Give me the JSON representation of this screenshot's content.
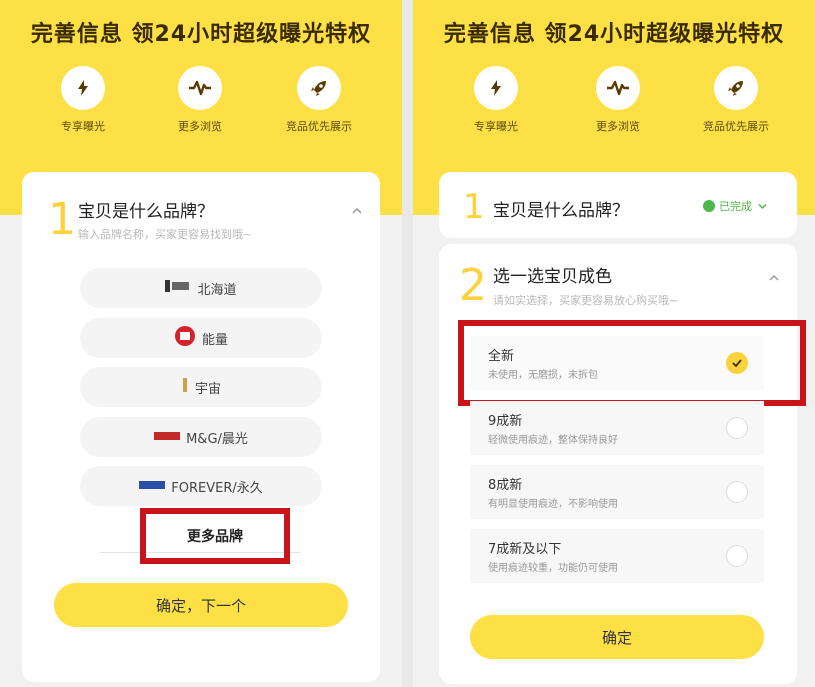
{
  "left": {
    "banner_title": "完善信息 领24小时超级曝光特权",
    "features": [
      {
        "icon": "lightning-icon",
        "label": "专享曝光"
      },
      {
        "icon": "pulse-icon",
        "label": "更多浏览"
      },
      {
        "icon": "rocket-icon",
        "label": "竞品优先展示"
      }
    ],
    "step": {
      "number": "1",
      "question": "宝贝是什么品牌？",
      "hint": "输入品牌名称，买家更容易找到哦~",
      "collapse_icon": "chevron-up-icon"
    },
    "brands": [
      {
        "label": "北海道",
        "logo": "brand-logo-hokkaido"
      },
      {
        "label": "能量",
        "logo": "brand-logo-energy"
      },
      {
        "label": "宇宙",
        "logo": "brand-logo-universe"
      },
      {
        "label": "M&G/晨光",
        "logo": "brand-logo-mg"
      },
      {
        "label": "FOREVER/永久",
        "logo": "brand-logo-forever"
      }
    ],
    "more_label": "更多品牌",
    "confirm_label": "确定，下一个"
  },
  "right": {
    "banner_title": "完善信息 领24小时超级曝光特权",
    "features": [
      {
        "icon": "lightning-icon",
        "label": "专享曝光"
      },
      {
        "icon": "pulse-icon",
        "label": "更多浏览"
      },
      {
        "icon": "rocket-icon",
        "label": "竞品优先展示"
      }
    ],
    "step1": {
      "number": "1",
      "question": "宝贝是什么品牌？",
      "status": "已完成"
    },
    "step2": {
      "number": "2",
      "question": "选一选宝贝成色",
      "hint": "请如实选择，买家更容易放心购买哦~"
    },
    "options": [
      {
        "title": "全新",
        "desc": "未使用，无磨损，未拆包",
        "selected": true
      },
      {
        "title": "9成新",
        "desc": "轻微使用痕迹，整体保持良好",
        "selected": false
      },
      {
        "title": "8成新",
        "desc": "有明显使用痕迹，不影响使用",
        "selected": false
      },
      {
        "title": "7成新及以下",
        "desc": "使用痕迹较重，功能仍可使用",
        "selected": false
      }
    ],
    "confirm_label": "确定"
  },
  "colors": {
    "banner_yellow": "#fde045",
    "accent_yellow": "#fbd23c",
    "highlight_red": "#c8151b",
    "status_green": "#4cb84a"
  }
}
